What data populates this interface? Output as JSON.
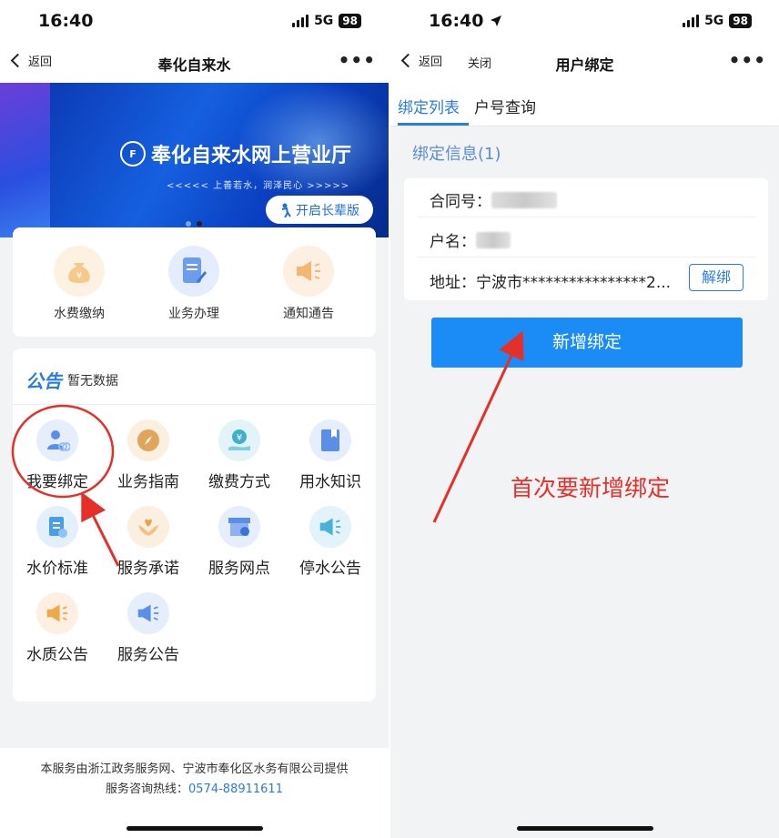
{
  "left": {
    "status": {
      "time": "16:40",
      "network": "5G",
      "battery": "98"
    },
    "nav": {
      "back": "返回",
      "title": "奉化自来水",
      "more": "•••"
    },
    "banner": {
      "logo": "F",
      "title": "奉化自来水网上营业厅",
      "subtitle": "<<<<< 上善若水，润泽民心 >>>>>",
      "elder_button": "开启长辈版"
    },
    "quick_actions": [
      {
        "label": "水费缴纳",
        "icon": "money-bag-icon",
        "color": "#f4c98c"
      },
      {
        "label": "业务办理",
        "icon": "document-edit-icon",
        "color": "#6b9cf0"
      },
      {
        "label": "通知通告",
        "icon": "megaphone-icon",
        "color": "#f4b673"
      }
    ],
    "notice": {
      "tag": "公告",
      "empty_text": "暂无数据"
    },
    "grid": [
      {
        "label": "我要绑定",
        "icon": "user-bind-icon",
        "color": "#5b8ee6"
      },
      {
        "label": "业务指南",
        "icon": "compass-icon",
        "color": "#e0a55a"
      },
      {
        "label": "缴费方式",
        "icon": "payment-hand-icon",
        "color": "#3fb0c8"
      },
      {
        "label": "用水知识",
        "icon": "book-icon",
        "color": "#5b8ee6"
      },
      {
        "label": "水价标准",
        "icon": "price-list-icon",
        "color": "#4a9ee8"
      },
      {
        "label": "服务承诺",
        "icon": "heart-hands-icon",
        "color": "#e8a24a"
      },
      {
        "label": "服务网点",
        "icon": "store-location-icon",
        "color": "#5b8ee6"
      },
      {
        "label": "停水公告",
        "icon": "megaphone-icon",
        "color": "#4ab0d8"
      },
      {
        "label": "水质公告",
        "icon": "megaphone-icon",
        "color": "#eda84a"
      },
      {
        "label": "服务公告",
        "icon": "megaphone-icon",
        "color": "#5b8ee6"
      }
    ],
    "footer": {
      "line1": "本服务由浙江政务服务网、宁波市奉化区水务有限公司提供",
      "hotline_label": "服务咨询热线：",
      "hotline_number": "0574-88911611"
    }
  },
  "right": {
    "status": {
      "time": "16:40",
      "network": "5G",
      "battery": "98"
    },
    "nav": {
      "back": "返回",
      "close": "关闭",
      "title": "用户绑定",
      "more": "•••"
    },
    "tabs": [
      "绑定列表",
      "户号查询"
    ],
    "section_title": "绑定信息(1)",
    "binding": {
      "contract_label": "合同号：",
      "name_label": "户名：",
      "address_label": "地址：",
      "address_value": "宁波市****************2...",
      "unbind_button": "解绑"
    },
    "add_button": "新增绑定",
    "annotation": "首次要新增绑定"
  },
  "colors": {
    "accent": "#2b7be0",
    "primary_button": "#1b8cf5",
    "annotation_red": "#e5302a"
  }
}
